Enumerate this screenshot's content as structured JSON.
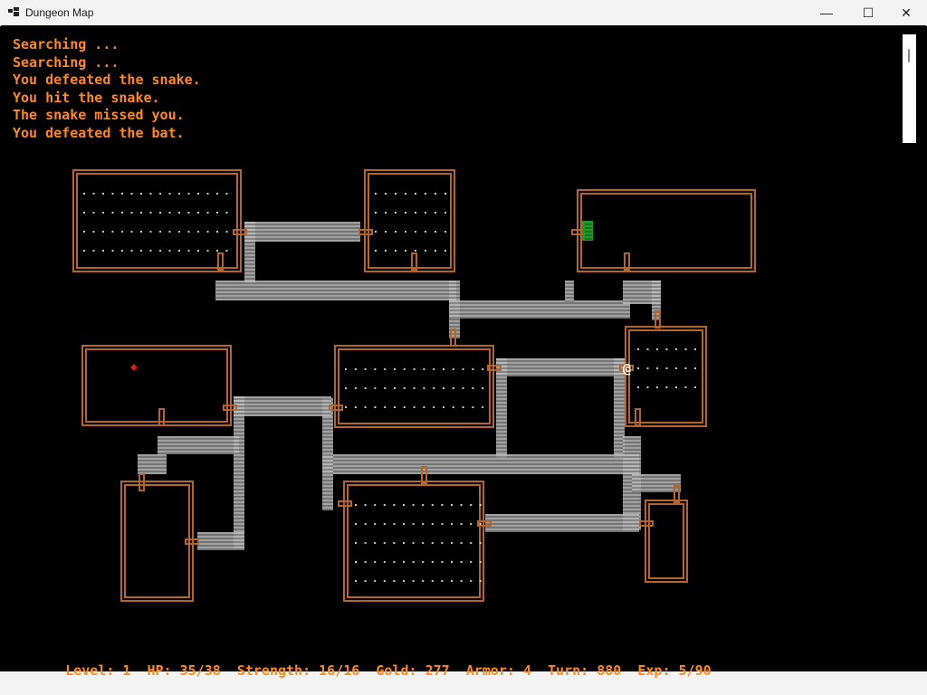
{
  "window": {
    "title": "Dungeon Map",
    "app_icon": "app-window-icon",
    "controls": [
      {
        "name": "minimize",
        "glyph": "—"
      },
      {
        "name": "maximize",
        "glyph": "☐"
      },
      {
        "name": "close",
        "glyph": "✕"
      }
    ]
  },
  "log": [
    "Searching ...",
    "Searching ...",
    "You defeated the snake.",
    "You hit the snake.",
    "The snake missed you.",
    "You defeated the bat."
  ],
  "player_glyph": "@",
  "status": {
    "level_label": "Level:",
    "level": "1",
    "hp_label": "HP:",
    "hp": "35/38",
    "strength_label": "Strength:",
    "strength": "16/16",
    "gold_label": "Gold:",
    "gold": "277",
    "armor_label": "Armor:",
    "armor": "4",
    "turn_label": "Turn:",
    "turn": "880",
    "exp_label": "Exp:",
    "exp": "5/90"
  },
  "colors": {
    "wall": "#b5652a",
    "text": "#ff8a1a",
    "floor_dot": "#c8c8c8",
    "corridor": "#bdbdbd",
    "stairs": "#1f9a2a",
    "item": "#d02020",
    "background": "#000000"
  },
  "map_legend": {
    "room": "room",
    "corridor": "corridor",
    "door": "door",
    "stairs": "stairs-icon",
    "item": "item-icon",
    "player": "player-icon"
  }
}
